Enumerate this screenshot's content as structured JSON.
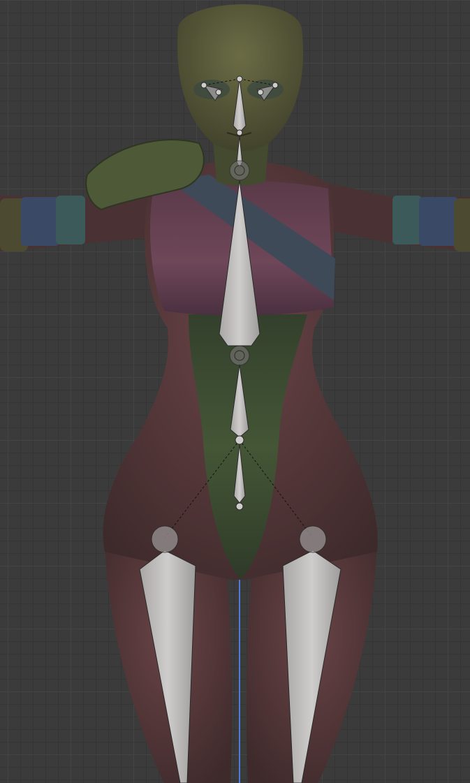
{
  "viewport": {
    "mode": "pose",
    "grid": true,
    "shading": "solid",
    "axis_line_color": "#4f7ad8"
  },
  "model": {
    "skin_color": "#5a3a3c",
    "head_color": "#5c5d3a",
    "torso_band_color": "#6a4455",
    "suit_color": "#3f4c33",
    "strap_color": "#3f4a58",
    "pauldron_color": "#4e5938",
    "cuff_teal_color": "#3c5a5a",
    "cuff_blue_color": "#3a4a66"
  },
  "armature": {
    "bone_fill": "#c4c1c1",
    "bone_edge": "#2a2a2a",
    "bones": [
      "head",
      "neck",
      "spine",
      "chest",
      "hips",
      "thigh-left",
      "thigh-right",
      "eye-left",
      "eye-right"
    ]
  }
}
